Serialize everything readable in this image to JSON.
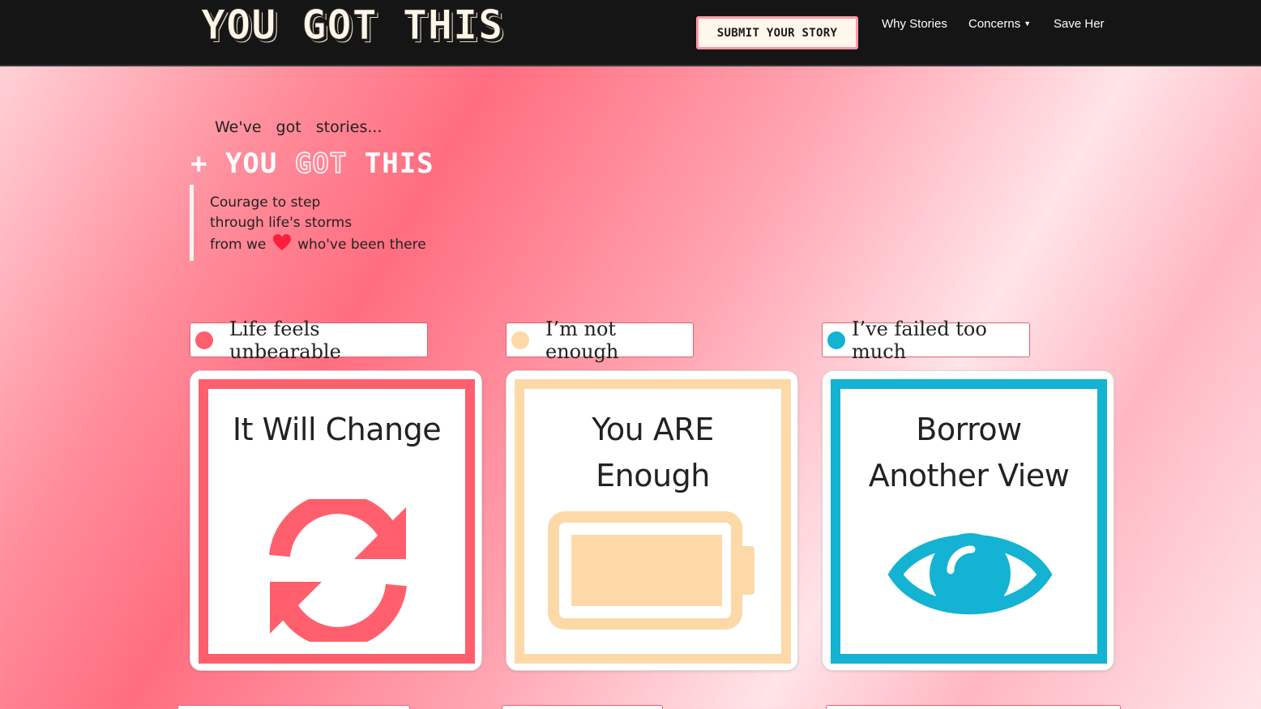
{
  "navbar": {
    "brand": "YOU GOT THIS",
    "submit_label": "Submit your story",
    "links": [
      {
        "label": "Why Stories"
      },
      {
        "label": "Concerns",
        "has_dropdown": true
      },
      {
        "label": "Save Her"
      }
    ]
  },
  "hero": {
    "intro": "We've got stories...",
    "title_prefix": "+ YOU",
    "title_mid": "GOT",
    "title_suffix": "THIS",
    "quote_line1": "Courage to step",
    "quote_line2": "through life's storms",
    "quote_line3a": "from we",
    "quote_line3b": "who've been there"
  },
  "tags": [
    {
      "label": "Life feels unbearable",
      "color": "#ff5f6d"
    },
    {
      "label": "I’m not enough",
      "color": "#fdd9a8"
    },
    {
      "label": "I’ve failed too much",
      "color": "#14b2d3"
    }
  ],
  "cards": [
    {
      "title": "It Will Change",
      "icon": "refresh-icon",
      "color": "#ff5f6d"
    },
    {
      "title_line1": "You ARE",
      "title_line2": "Enough",
      "icon": "battery-full-icon",
      "color": "#fdd9a8"
    },
    {
      "title_line1": "Borrow",
      "title_line2": "Another View",
      "icon": "eye-icon",
      "color": "#14b2d3"
    }
  ],
  "colors": {
    "navbar_bg": "#151515",
    "heart": "#ff1e3c"
  }
}
